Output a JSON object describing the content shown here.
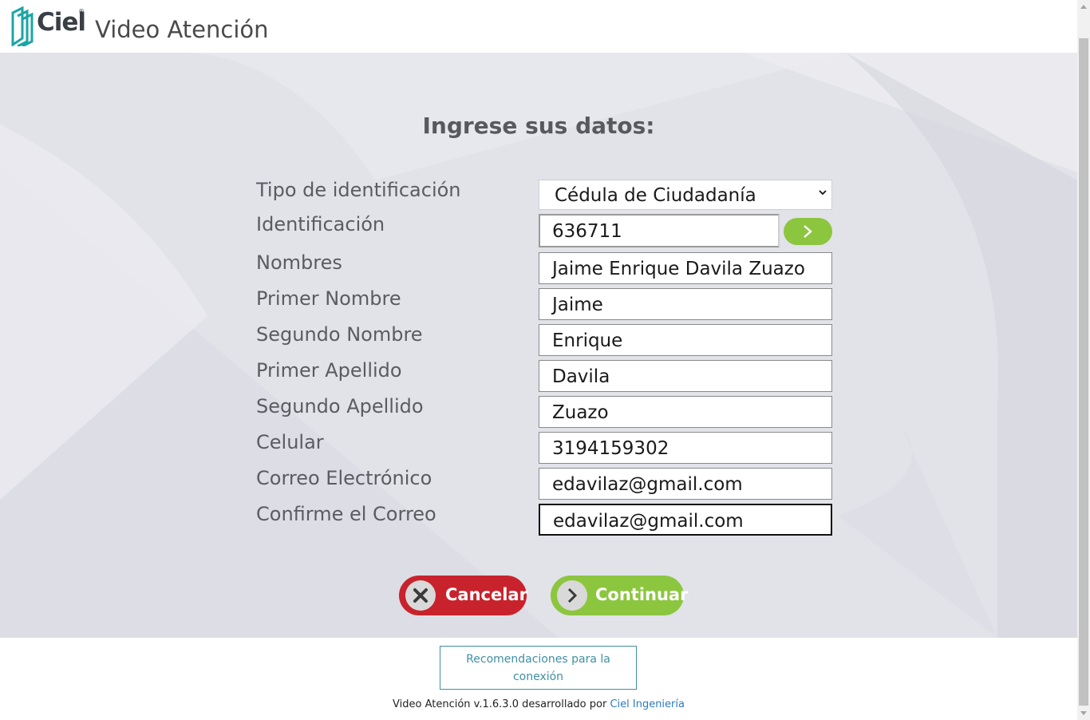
{
  "header": {
    "logo_text": "Ciel",
    "logo_reg": "®",
    "app_title": "Video Atención"
  },
  "form": {
    "title": "Ingrese sus datos:",
    "tipo_label": "Tipo de identificación",
    "tipo_value": "Cédula de Ciudadanía",
    "identificacion_label": "Identificación",
    "identificacion_value": "636711",
    "nombres_label": "Nombres",
    "nombres_value": "Jaime Enrique Davila Zuazo",
    "primer_nombre_label": "Primer Nombre",
    "primer_nombre_value": "Jaime",
    "segundo_nombre_label": "Segundo Nombre",
    "segundo_nombre_value": "Enrique",
    "primer_apellido_label": "Primer Apellido",
    "primer_apellido_value": "Davila",
    "segundo_apellido_label": "Segundo Apellido",
    "segundo_apellido_value": "Zuazo",
    "celular_label": "Celular",
    "celular_value": "3194159302",
    "correo_label": "Correo Electrónico",
    "correo_value": "edavilaz@gmail.com",
    "confirme_label": "Confirme el Correo",
    "confirme_value": "edavilaz@gmail.com"
  },
  "actions": {
    "cancel_label": "Cancelar",
    "continue_label": "Continuar"
  },
  "footer": {
    "recommendations_label": "Recomendaciones para la conexión",
    "version_text": "Video Atención v.1.6.3.0 desarrollado por",
    "developer_link": "Ciel Ingeniería"
  },
  "colors": {
    "accent_green": "#8cc63f",
    "cancel_red": "#c8232c",
    "logo_teal": "#1ba5a6",
    "link_blue": "#2a7bbd"
  },
  "icons": [
    "ciel-logo-icon",
    "dropdown-caret-icon",
    "chevron-right-icon",
    "close-x-icon"
  ]
}
